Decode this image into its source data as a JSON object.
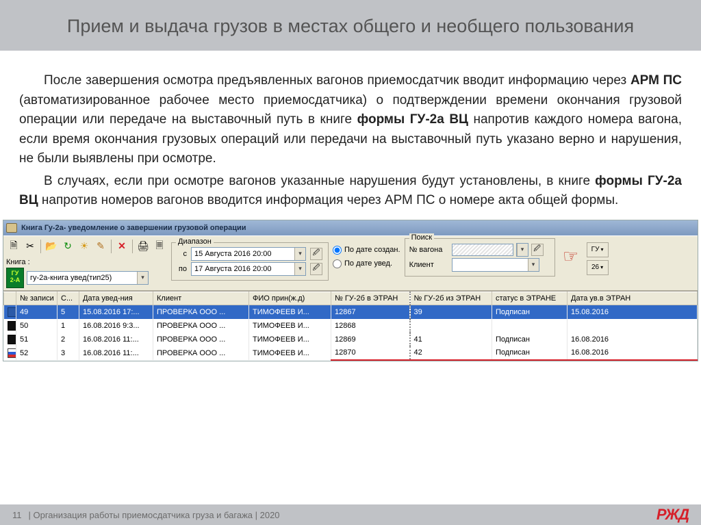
{
  "slide": {
    "title": "Прием и выдача грузов в местах общего и необщего пользования",
    "para1_pre": "После завершения осмотра предъявленных вагонов приемосдатчик вводит информацию через ",
    "para1_b1": "АРМ ПС",
    "para1_mid": " (автоматизированное рабочее место приемосдатчика) о подтверждении времени окончания грузовой операции или передаче на выставочный путь в книге ",
    "para1_b2": "формы ГУ-2а ВЦ",
    "para1_post": " напротив каждого номера вагона, если время окончания грузовых операций или передачи на выставочный путь указано верно и нарушения, не были выявлены при осмотре.",
    "para2_pre": "В случаях, если при осмотре вагонов указанные нарушения будут установлены, в книге ",
    "para2_b1": "формы ГУ-2а ВЦ",
    "para2_post": " напротив номеров вагонов вводится информация через АРМ ПС о номере акта общей формы."
  },
  "app": {
    "window_title": "Книга Гу-2а- уведомление о завершении грузовой операции",
    "book_label": "Книга :",
    "badge_line1": "ГУ",
    "badge_line2": "2-А",
    "book_combo": "гу-2а-книга увед(тип25)",
    "range_legend": "Диапазон",
    "range_from_lbl": "с",
    "range_from": "15 Августа 2016 20:00",
    "range_to_lbl": "по",
    "range_to": "17 Августа 2016 20:00",
    "radio1": "По дате создан.",
    "radio2": "По дате увед.",
    "search_legend": "Поиск",
    "search_wagon_lbl": "№ вагона",
    "search_client_lbl": "Клиент",
    "gu26_top": "ГУ",
    "gu26_bottom": "26"
  },
  "table": {
    "headers": {
      "rec": "№ записи",
      "s": "С...",
      "date": "Дата увед-ния",
      "client": "Клиент",
      "fio": "ФИО прин(ж.д)",
      "gu_in": "№ ГУ-2б в ЭТРАН",
      "gu_out": "№ ГУ-2б из ЭТРАН",
      "status": "статус в ЭТРАНЕ",
      "date_etran": "Дата ув.в ЭТРАН"
    },
    "rows": [
      {
        "icon": "blue",
        "rec": "49",
        "s": "5",
        "date": "15.08.2016 17:...",
        "client": "ПРОВЕРКА  ООО ...",
        "fio": "ТИМОФЕЕВ И...",
        "gu_in": "12867",
        "gu_out": "39",
        "status": "Подписан",
        "date_etran": "15.08.2016",
        "selected": true
      },
      {
        "icon": "black",
        "rec": "50",
        "s": "1",
        "date": "16.08.2016 9:3...",
        "client": "ПРОВЕРКА  ООО ...",
        "fio": "ТИМОФЕЕВ И...",
        "gu_in": "12868",
        "gu_out": "",
        "status": "",
        "date_etran": ""
      },
      {
        "icon": "black",
        "rec": "51",
        "s": "2",
        "date": "16.08.2016 11:...",
        "client": "ПРОВЕРКА  ООО ...",
        "fio": "ТИМОФЕЕВ И...",
        "gu_in": "12869",
        "gu_out": "41",
        "status": "Подписан",
        "date_etran": "16.08.2016"
      },
      {
        "icon": "flag",
        "rec": "52",
        "s": "3",
        "date": "16.08.2016 11:...",
        "client": "ПРОВЕРКА  ООО ...",
        "fio": "ТИМОФЕЕВ И...",
        "gu_in": "12870",
        "gu_out": "42",
        "status": "Подписан",
        "date_etran": "16.08.2016"
      }
    ]
  },
  "footer": {
    "page": "11",
    "text": "| Организация работы приемосдатчика груза и багажа | 2020",
    "logo": "РЖД"
  }
}
